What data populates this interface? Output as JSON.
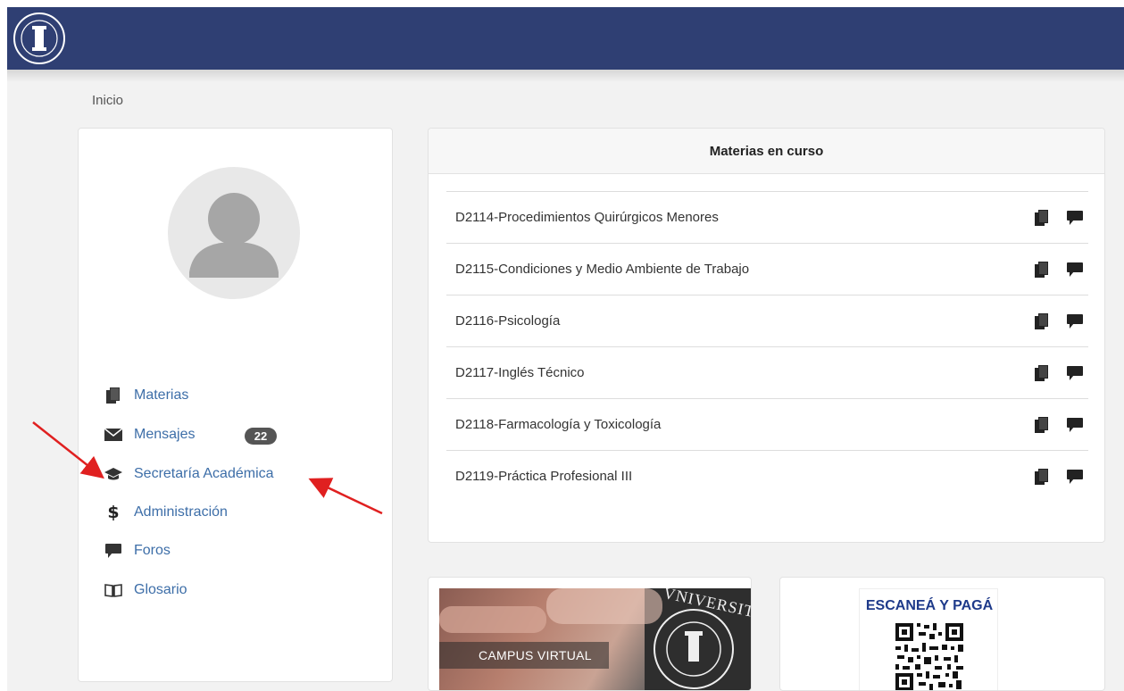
{
  "header": {
    "logo": "universitas-seal-icon"
  },
  "breadcrumb": {
    "home": "Inicio"
  },
  "sidebar": {
    "avatar": "user-silhouette-icon",
    "items": [
      {
        "label": "Materias",
        "icon": "books-icon"
      },
      {
        "label": "Mensajes",
        "icon": "envelope-icon",
        "badge": "22"
      },
      {
        "label": "Secretaría Académica",
        "icon": "graduation-cap-icon"
      },
      {
        "label": "Administración",
        "icon": "dollar-icon"
      },
      {
        "label": "Foros",
        "icon": "speech-bubble-icon"
      },
      {
        "label": "Glosario",
        "icon": "open-book-icon"
      }
    ]
  },
  "courses": {
    "title": "Materias en curso",
    "items": [
      {
        "name": "D2114-Procedimientos Quirúrgicos Menores"
      },
      {
        "name": "D2115-Condiciones y Medio Ambiente de Trabajo"
      },
      {
        "name": "D2116-Psicología"
      },
      {
        "name": "D2117-Inglés Técnico"
      },
      {
        "name": "D2118-Farmacología y Toxicología"
      },
      {
        "name": "D2119-Práctica Profesional III"
      }
    ]
  },
  "campus_banner": {
    "label": "CAMPUS VIRTUAL",
    "watermark": "VNIVERSITAS"
  },
  "payment": {
    "title": "ESCANEÁ Y PAGÁ"
  },
  "colors": {
    "header": "#2f3f73",
    "link": "#3d6ea8",
    "annotation_arrow": "#e02020"
  }
}
